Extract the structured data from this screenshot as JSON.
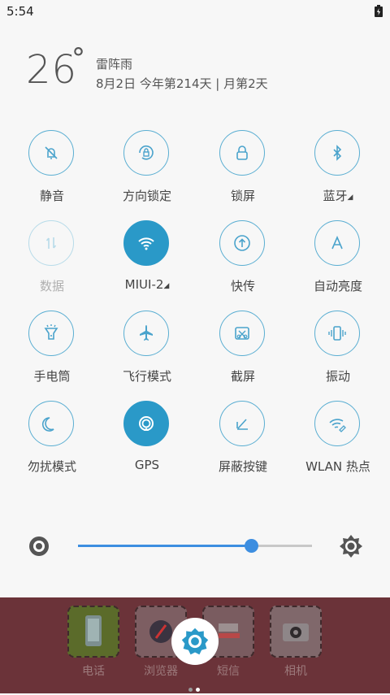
{
  "status": {
    "time": "5:54"
  },
  "weather": {
    "temperature": "26",
    "degree": "°",
    "condition": "雷阵雨",
    "date_line": "8月2日 今年第214天 | 月第2天"
  },
  "tiles": [
    {
      "label": "静音",
      "icon": "bell-off-icon",
      "state": "off"
    },
    {
      "label": "方向锁定",
      "icon": "rotation-lock-icon",
      "state": "off"
    },
    {
      "label": "锁屏",
      "icon": "lock-icon",
      "state": "off"
    },
    {
      "label": "蓝牙",
      "icon": "bluetooth-icon",
      "state": "off",
      "has_arrow": true
    },
    {
      "label": "数据",
      "icon": "mobile-data-icon",
      "state": "disabled"
    },
    {
      "label": "MIUI-2",
      "icon": "wifi-icon",
      "state": "on",
      "has_arrow": true
    },
    {
      "label": "快传",
      "icon": "quick-transfer-icon",
      "state": "off"
    },
    {
      "label": "自动亮度",
      "icon": "auto-brightness-icon",
      "state": "off"
    },
    {
      "label": "手电筒",
      "icon": "flashlight-icon",
      "state": "off"
    },
    {
      "label": "飞行模式",
      "icon": "airplane-icon",
      "state": "off"
    },
    {
      "label": "截屏",
      "icon": "screenshot-icon",
      "state": "off"
    },
    {
      "label": "振动",
      "icon": "vibrate-icon",
      "state": "off"
    },
    {
      "label": "勿扰模式",
      "icon": "moon-icon",
      "state": "off"
    },
    {
      "label": "GPS",
      "icon": "gps-icon",
      "state": "on"
    },
    {
      "label": "屏蔽按键",
      "icon": "block-keys-icon",
      "state": "off"
    },
    {
      "label": "WLAN 热点",
      "icon": "hotspot-icon",
      "state": "off"
    }
  ],
  "brightness": {
    "level": 0.74
  },
  "dock": {
    "apps": [
      {
        "label": "电话"
      },
      {
        "label": "浏览器"
      },
      {
        "label": "短信"
      },
      {
        "label": "相机"
      }
    ]
  },
  "colors": {
    "accent": "#2a99c8",
    "slider": "#3d8ee0",
    "dock_bg": "#6b3339"
  }
}
